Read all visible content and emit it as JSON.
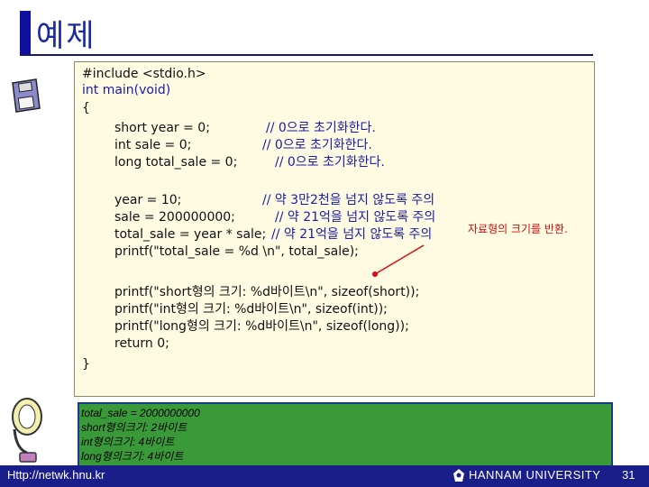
{
  "slide": {
    "title": "예제",
    "footer_url": "Http://netwk.hnu.kr",
    "footer_university": "HANNAM UNIVERSITY",
    "page_number": "31"
  },
  "code": {
    "lines": [
      "#include <stdio.h>",
      "int main(void)",
      "{",
      "short year = 0;",
      "int sale = 0;",
      "long total_sale = 0;",
      "year = 10;",
      "sale = 200000000;",
      "total_sale = year * sale;",
      "printf(\"total_sale = %d \\n\", total_sale);",
      "printf(\"short형의 크기: %d바이트\\n\", sizeof(short));",
      "printf(\"int형의 크기: %d바이트\\n\", sizeof(int));",
      "printf(\"long형의 크기: %d바이트\\n\", sizeof(long));",
      "return 0;",
      "}"
    ],
    "comments": [
      "// 0으로 초기화한다.",
      "// 0으로 초기화한다.",
      "// 0으로 초기화한다.",
      "// 약 3만2천을 넘지 않도록 주의",
      "// 약 21억을 넘지 않도록 주의",
      "// 약 21억을 넘지 않도록 주의"
    ],
    "annotation": "자료형의 크기를 반환."
  },
  "output": {
    "lines": [
      "total_sale = 2000000000",
      "short형의크기: 2바이트",
      "int형의크기: 4바이트",
      "long형의크기: 4바이트"
    ]
  },
  "colors": {
    "title": "#1a2aa0",
    "code_background": "#fffbe2",
    "output_background": "#3a9a3a",
    "footer": "#1a1e8a",
    "annotation": "#d01010"
  },
  "icons": [
    "floppy-disk-icon",
    "desk-lamp-icon",
    "university-logo-icon"
  ]
}
